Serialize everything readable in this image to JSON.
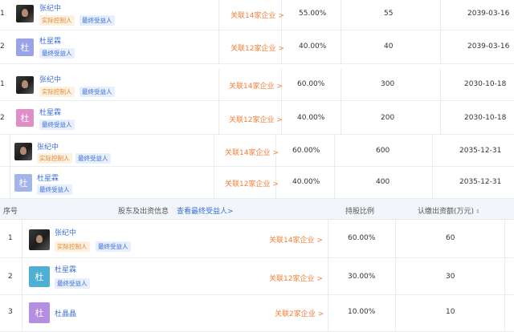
{
  "block1": {
    "rows": [
      {
        "index": "1",
        "name": "张纪中",
        "tags": [
          "实际控制人",
          "最终受益人"
        ],
        "avatar_char": "",
        "avatar": "photo",
        "related": "关联14家企业 >",
        "ratio": "55.00%",
        "amount": "55",
        "date": "2039-03-16"
      },
      {
        "index": "2",
        "name": "杜星霖",
        "tags": [
          "最终受益人"
        ],
        "avatar_char": "杜",
        "avatar": "purple",
        "related": "关联12家企业 >",
        "ratio": "40.00%",
        "amount": "40",
        "date": "2039-03-16"
      }
    ]
  },
  "block2": {
    "rows": [
      {
        "index": "1",
        "name": "张纪中",
        "tags": [
          "实际控制人",
          "最终受益人"
        ],
        "avatar_char": "",
        "avatar": "photo",
        "related": "关联14家企业 >",
        "ratio": "60.00%",
        "amount": "300",
        "date": "2030-10-18"
      },
      {
        "index": "2",
        "name": "杜星霖",
        "tags": [
          "最终受益人"
        ],
        "avatar_char": "杜",
        "avatar": "pink",
        "related": "关联12家企业 >",
        "ratio": "40.00%",
        "amount": "200",
        "date": "2030-10-18"
      }
    ]
  },
  "block3": {
    "rows": [
      {
        "name": "张纪中",
        "tags": [
          "实际控制人",
          "最终受益人"
        ],
        "avatar_char": "",
        "avatar": "photo",
        "related": "关联14家企业 >",
        "ratio": "60.00%",
        "amount": "600",
        "date": "2035-12-31"
      },
      {
        "name": "杜星霖",
        "tags": [
          "最终受益人"
        ],
        "avatar_char": "杜",
        "avatar": "lblue",
        "related": "关联12家企业 >",
        "ratio": "40.00%",
        "amount": "400",
        "date": "2035-12-31"
      }
    ]
  },
  "header": {
    "index": "序号",
    "shareholder": "股东及出资信息",
    "view_beneficiary": "查看最终受益人>",
    "ratio": "持股比例",
    "amount": "认缴出资额(万元)",
    "sort_icon": "sort-icon"
  },
  "block4": {
    "rows": [
      {
        "index": "1",
        "name": "张纪中",
        "tags": [
          "实际控制人",
          "最终受益人"
        ],
        "avatar_char": "",
        "avatar": "photo",
        "related": "关联14家企业 >",
        "ratio": "60.00%",
        "amount": "60"
      },
      {
        "index": "2",
        "name": "杜星霖",
        "tags": [
          "最终受益人"
        ],
        "avatar_char": "杜",
        "avatar": "teal",
        "related": "关联12家企业 >",
        "ratio": "30.00%",
        "amount": "30"
      },
      {
        "index": "3",
        "name": "杜晶晶",
        "tags": [],
        "avatar_char": "杜",
        "avatar": "lilac",
        "related": "关联2家企业 >",
        "ratio": "10.00%",
        "amount": "10"
      }
    ]
  }
}
